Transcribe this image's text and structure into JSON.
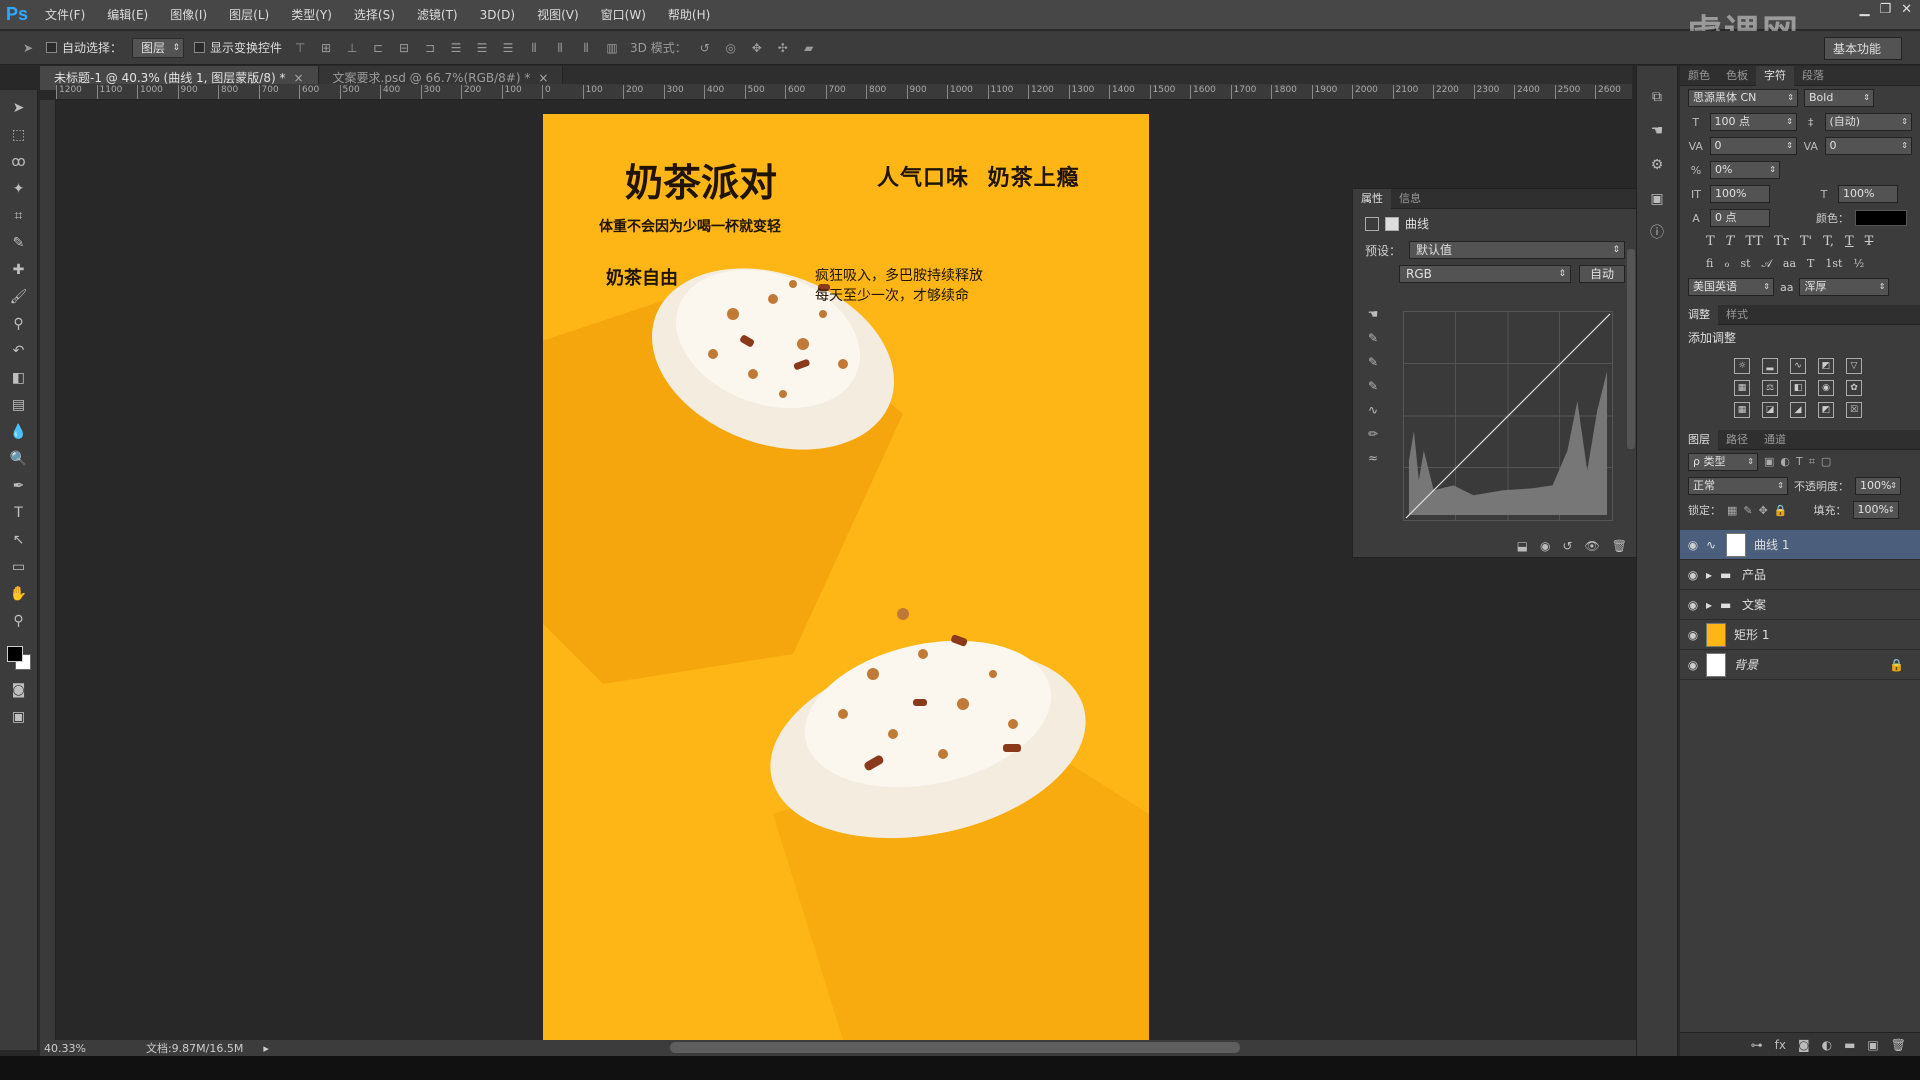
{
  "menubar": {
    "logo": "Ps",
    "items": [
      "文件(F)",
      "编辑(E)",
      "图像(I)",
      "图层(L)",
      "类型(Y)",
      "选择(S)",
      "滤镜(T)",
      "3D(D)",
      "视图(V)",
      "窗口(W)",
      "帮助(H)"
    ],
    "watermark": "虎课网"
  },
  "options": {
    "auto_select_label": "自动选择：",
    "auto_select_value": "图层",
    "show_transform_label": "显示变换控件",
    "mode_3d_label": "3D 模式：",
    "workspace": "基本功能"
  },
  "tabs": [
    {
      "label": "未标题-1 @ 40.3% (曲线 1, 图层蒙版/8) *"
    },
    {
      "label": "文案要求.psd @ 66.7%(RGB/8#) *"
    }
  ],
  "ruler": {
    "h_ticks": [
      "1200",
      "1100",
      "1000",
      "900",
      "800",
      "700",
      "600",
      "500",
      "400",
      "300",
      "200",
      "100",
      "0",
      "100",
      "200",
      "300",
      "400",
      "500",
      "600",
      "700",
      "800",
      "900",
      "1000",
      "1100",
      "1200",
      "1300",
      "1400",
      "1500",
      "1600",
      "1700",
      "1800",
      "1900",
      "2000",
      "2100",
      "2200",
      "2300",
      "2400",
      "2500",
      "2600"
    ]
  },
  "poster": {
    "headline": "奶茶派对",
    "tagline": "人气口味 奶茶上瘾",
    "subline": "体重不会因为少喝一杯就变轻",
    "freedom": "奶茶自由",
    "desc_line1": "疯狂吸入，多巴胺持续释放",
    "desc_line2": "每天至少一次，才够续命",
    "bg_color": "#fdb616"
  },
  "properties_panel": {
    "tabs": [
      "属性",
      "信息"
    ],
    "title": "曲线",
    "preset_label": "预设：",
    "preset_value": "默认值",
    "channel_value": "RGB",
    "auto_button": "自动"
  },
  "character_panel": {
    "tabs": [
      "颜色",
      "色板",
      "字符",
      "段落"
    ],
    "font_family": "思源黑体 CN",
    "font_style": "Bold",
    "font_size": "100 点",
    "leading": "(自动)",
    "kerning": "0",
    "tracking": "0",
    "tsume": "0%",
    "vscale": "100%",
    "hscale": "100%",
    "baseline": "0 点",
    "color_label": "颜色：",
    "language": "美国英语",
    "aa_label": "aa",
    "antialias": "浑厚",
    "typo_buttons": [
      "T",
      "T",
      "TT",
      "Tr",
      "T'",
      "T,",
      "T",
      "T"
    ]
  },
  "adjustments_panel": {
    "tabs": [
      "调整",
      "样式"
    ],
    "title": "添加调整"
  },
  "layers_panel": {
    "tabs": [
      "图层",
      "路径",
      "通道"
    ],
    "filter_label": "ρ 类型",
    "blend_mode": "正常",
    "opacity_label": "不透明度：",
    "opacity": "100%",
    "lock_label": "锁定：",
    "fill_label": "填充：",
    "fill": "100%",
    "layers": [
      {
        "name": "曲线 1",
        "selected": true
      },
      {
        "name": "产品",
        "group": true
      },
      {
        "name": "文案",
        "group": true
      },
      {
        "name": "矩形 1"
      },
      {
        "name": "背景",
        "locked": true
      }
    ]
  },
  "status": {
    "zoom": "40.33%",
    "doc_size": "文档:9.87M/16.5M"
  }
}
